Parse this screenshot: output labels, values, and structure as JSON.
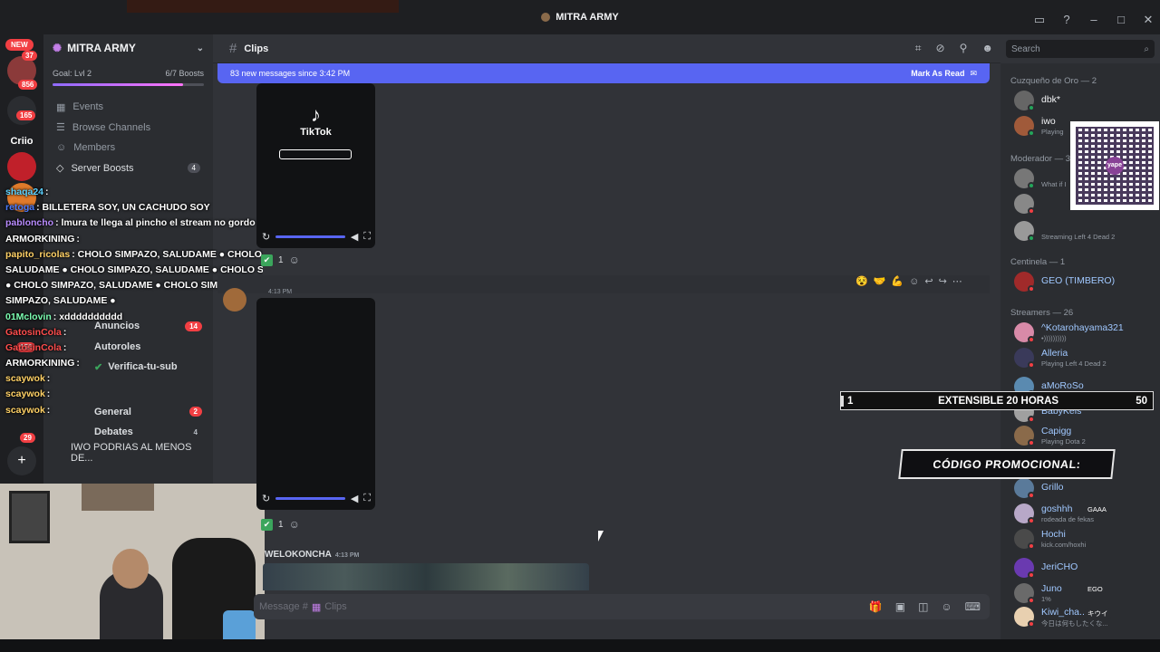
{
  "window": {
    "title": "MITRA ARMY"
  },
  "rail": {
    "new_label": "NEW",
    "badges": [
      "37",
      "856",
      "165",
      "156",
      "29"
    ],
    "server_short": "Criio"
  },
  "guild": {
    "name": "MITRA ARMY",
    "boost_goal": "Goal: Lvl 2",
    "boost_count": "6/7 Boosts",
    "boost_progress": 0.86
  },
  "nav": {
    "events": "Events",
    "browse": "Browse Channels",
    "members": "Members",
    "server_boosts": "Server Boosts",
    "server_boosts_count": "4"
  },
  "channels": [
    {
      "name": "Anuncios",
      "count": "14"
    },
    {
      "name": "Autoroles",
      "count": ""
    },
    {
      "name": "Verifica-tu-sub",
      "count": ""
    },
    {
      "name": "General",
      "count": "2"
    },
    {
      "name": "Debates",
      "count": "4"
    }
  ],
  "thread": "IWO PODRIAS AL MENOS DE...",
  "stream_chat": [
    {
      "user": "shaqa24",
      "color": "#5bd1ff",
      "text": ":"
    },
    {
      "user": "retoga",
      "color": "#4a7bff",
      "text": ": BILLETERA SOY, UN CACHUDO SOY"
    },
    {
      "user": "pabloncho",
      "color": "#b98cff",
      "text": ": lmura te llega al pincho el stream no gordo c"
    },
    {
      "user": "ARMORKINING",
      "color": "#ffffff",
      "text": ":"
    },
    {
      "user": "papito_ricolas",
      "color": "#ffd166",
      "text": ": CHOLO SIMPAZO, SALUDAME ● CHOLO S"
    },
    {
      "user": "",
      "color": "#ffffff",
      "text": "SALUDAME ● CHOLO SIMPAZO, SALUDAME ● CHOLO S"
    },
    {
      "user": "",
      "color": "#ffffff",
      "text": "● CHOLO SIMPAZO, SALUDAME ● CHOLO SIMPAZO, SA"
    },
    {
      "user": "",
      "color": "#ffffff",
      "text": "SIMPAZO, SALUDAME ●"
    },
    {
      "user": "01Mclovin",
      "color": "#7cffb2",
      "text": ": xdddddddddd"
    },
    {
      "user": "GatosinCola",
      "color": "#ff4d4d",
      "text": ":"
    },
    {
      "user": "GatosinCola",
      "color": "#ff4d4d",
      "text": ":"
    },
    {
      "user": "ARMORKINING",
      "color": "#ffffff",
      "text": ":"
    },
    {
      "user": "scaywok",
      "color": "#ffd166",
      "text": ":"
    },
    {
      "user": "scaywok",
      "color": "#ffd166",
      "text": ":"
    },
    {
      "user": "scaywok",
      "color": "#ffd166",
      "text": ":"
    }
  ],
  "main": {
    "channel_name": "Clips",
    "new_messages": "83 new messages since 3:42 PM",
    "mark_as_read": "Mark As Read",
    "tiktok_label": "TikTok",
    "reaction_count_1": "1",
    "reaction_count_2": "1",
    "msg_time": "4:13 PM",
    "author2": "WELOKONCHA",
    "author2_time": "4:13 PM",
    "composer_placeholder": "Message #",
    "composer_channel": "Clips"
  },
  "search": {
    "placeholder": "Search"
  },
  "member_groups": {
    "g1": "Cuzqueño de Oro — 2",
    "g2": "Moderador — 3",
    "g3": "Centinela — 1",
    "g4": "Streamers — 26"
  },
  "members": [
    {
      "name": "dbk*",
      "status": "",
      "color": "#f2f3f5"
    },
    {
      "name": "iwo",
      "status": "Playing",
      "color": "#f2f3f5"
    },
    {
      "name": "",
      "status": "What if I",
      "color": "#f2f3f5"
    },
    {
      "name": "",
      "status": "",
      "color": "#f2f3f5"
    },
    {
      "name": "",
      "status": "Streaming Left 4 Dead 2",
      "color": "#f2f3f5"
    },
    {
      "name": "GEO (TIMBERO)",
      "status": "",
      "color": "#a0c8ff"
    },
    {
      "name": "^Kotarohayama321",
      "status": "•))))))))))",
      "color": "#a0c8ff"
    },
    {
      "name": "Alleria",
      "status": "Playing Left 4 Dead 2",
      "color": "#a0c8ff"
    },
    {
      "name": "aMoRoSo",
      "status": "",
      "color": "#a0c8ff"
    },
    {
      "name": "BabyKels",
      "status": "",
      "color": "#a0c8ff"
    },
    {
      "name": "Capigg",
      "status": "Playing Dota 2",
      "color": "#a0c8ff"
    },
    {
      "name": "Grillo",
      "status": "",
      "color": "#a0c8ff"
    },
    {
      "name": "goshhh",
      "status": "rodeada de fekas",
      "color": "#a0c8ff"
    },
    {
      "name": "Hochi",
      "status": "kick.com/hoxhi",
      "color": "#a0c8ff"
    },
    {
      "name": "JeriCHO",
      "status": "",
      "color": "#a0c8ff"
    },
    {
      "name": "Juno",
      "status": "1%",
      "color": "#a0c8ff"
    },
    {
      "name": "Kiwi_cha...",
      "status": "今日は何もしたくな...",
      "color": "#a0c8ff"
    }
  ],
  "tags": {
    "goshhh": "GAAA",
    "juno": "EGO",
    "kiwi": "キウイ"
  },
  "overlays": {
    "qr_label": "yape",
    "subgoal_left": "1",
    "subgoal_text": "EXTENSIBLE 20 HORAS",
    "subgoal_right": "50",
    "promo": "CÓDIGO PROMOCIONAL:"
  }
}
